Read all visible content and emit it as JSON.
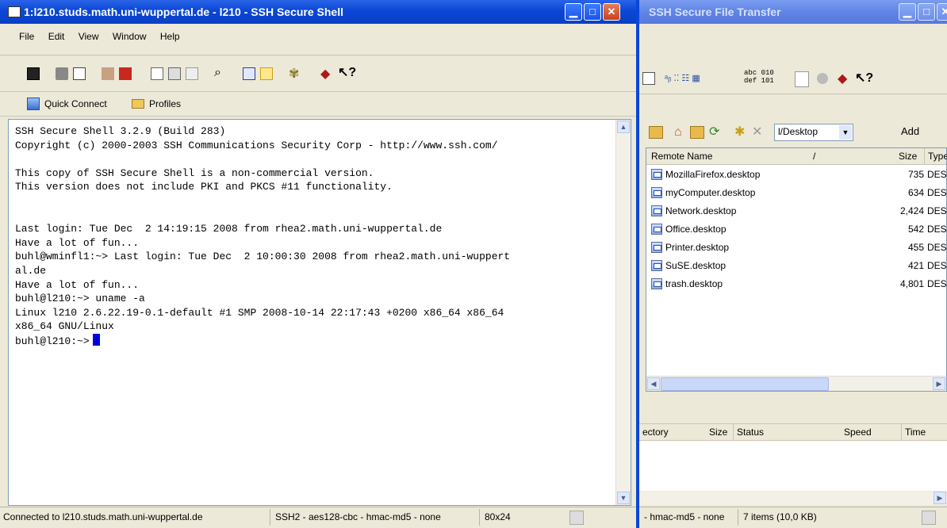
{
  "ssh_window": {
    "title": "1:l210.studs.math.uni-wuppertal.de - l210 - SSH Secure Shell",
    "menu": [
      "File",
      "Edit",
      "View",
      "Window",
      "Help"
    ],
    "quick_connect": "Quick Connect",
    "profiles": "Profiles",
    "terminal_lines": [
      "SSH Secure Shell 3.2.9 (Build 283)",
      "Copyright (c) 2000-2003 SSH Communications Security Corp - http://www.ssh.com/",
      "",
      "This copy of SSH Secure Shell is a non-commercial version.",
      "This version does not include PKI and PKCS #11 functionality.",
      "",
      "",
      "Last login: Tue Dec  2 14:19:15 2008 from rhea2.math.uni-wuppertal.de",
      "Have a lot of fun...",
      "buhl@wminfl1:~> Last login: Tue Dec  2 10:00:30 2008 from rhea2.math.uni-wuppert",
      "al.de",
      "Have a lot of fun...",
      "buhl@l210:~> uname -a",
      "Linux l210 2.6.22.19-0.1-default #1 SMP 2008-10-14 22:17:43 +0200 x86_64 x86_64",
      "x86_64 GNU/Linux"
    ],
    "prompt": "buhl@l210:~>",
    "status": {
      "connection": "Connected to l210.studs.math.uni-wuppertal.de",
      "cipher": "SSH2 - aes128-cbc - hmac-md5 - none",
      "size": "80x24"
    }
  },
  "sftp_window": {
    "title": "SSH Secure File Transfer",
    "path": "l/Desktop",
    "add_label": "Add",
    "columns": {
      "name": "Remote Name",
      "size": "Size",
      "type": "Type"
    },
    "files": [
      {
        "name": "MozillaFirefox.desktop",
        "size": "735",
        "type": "DESKTO"
      },
      {
        "name": "myComputer.desktop",
        "size": "634",
        "type": "DESKTO"
      },
      {
        "name": "Network.desktop",
        "size": "2,424",
        "type": "DESKTO"
      },
      {
        "name": "Office.desktop",
        "size": "542",
        "type": "DESKTO"
      },
      {
        "name": "Printer.desktop",
        "size": "455",
        "type": "DESKTO"
      },
      {
        "name": "SuSE.desktop",
        "size": "421",
        "type": "DESKTO"
      },
      {
        "name": "trash.desktop",
        "size": "4,801",
        "type": "DESKTO"
      }
    ],
    "transfer_columns": {
      "directory": "ectory",
      "size": "Size",
      "status": "Status",
      "speed": "Speed",
      "time": "Time"
    },
    "toolbar_text": {
      "abc": "abc 010",
      "def": "def 101"
    },
    "status": {
      "cipher": "- hmac-md5 - none",
      "items": "7 items (10,0 KB)"
    }
  }
}
